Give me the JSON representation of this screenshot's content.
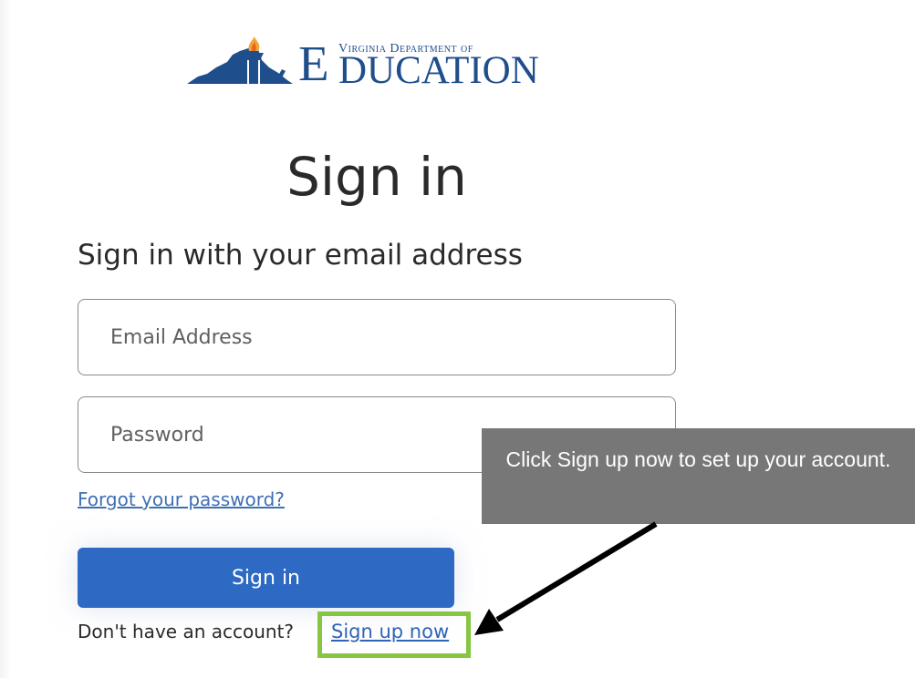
{
  "logo": {
    "line_top": "Virginia Department of",
    "big_letter": "E",
    "line_bottom": "DUCATION"
  },
  "page_title": "Sign in",
  "subtitle": "Sign in with your email address",
  "email_field": {
    "placeholder": "Email Address",
    "value": ""
  },
  "password_field": {
    "placeholder": "Password",
    "value": ""
  },
  "forgot_link": "Forgot your password?",
  "signin_button": "Sign in",
  "signup_prompt": "Don't have an account?",
  "signup_link": "Sign up now",
  "callout": {
    "text": "Click Sign up now to set up your account."
  },
  "colors": {
    "primary_button": "#2e6ac3",
    "link": "#2f63b6",
    "highlight": "#86c640",
    "callout_bg": "#777777",
    "logo_blue": "#1f4e8c",
    "logo_flame": "#f4a23a"
  }
}
